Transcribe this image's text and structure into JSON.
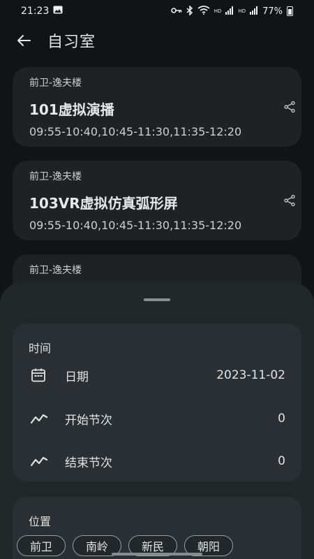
{
  "status_bar": {
    "time": "21:23",
    "battery": "77%",
    "icons": [
      "image-icon",
      "key-icon",
      "bluetooth-icon",
      "wifi-icon",
      "signal-icon",
      "signal-icon",
      "battery-icon"
    ],
    "hd1": "HD",
    "hd2": "HD"
  },
  "app_bar": {
    "title": "自习室"
  },
  "rooms": [
    {
      "building": "前卫-逸夫楼",
      "name": "101虚拟演播",
      "times": "09:55-10:40,10:45-11:30,11:35-12:20"
    },
    {
      "building": "前卫-逸夫楼",
      "name": "103VR虚拟仿真弧形屏",
      "times": "09:55-10:40,10:45-11:30,11:35-12:20"
    },
    {
      "building": "前卫-逸夫楼",
      "name": "",
      "times": ""
    }
  ],
  "filter_sheet": {
    "time_section": {
      "title": "时间",
      "date_label": "日期",
      "date_value": "2023-11-02",
      "start_label": "开始节次",
      "start_value": "0",
      "end_label": "结束节次",
      "end_value": "0"
    },
    "location_section": {
      "title": "位置",
      "campuses": [
        "前卫",
        "南岭",
        "新民",
        "朝阳"
      ]
    }
  },
  "colors": {
    "background": "#111416",
    "card": "#1e2225",
    "sheet": "#22272a",
    "sheet_card": "#2a2f33"
  }
}
